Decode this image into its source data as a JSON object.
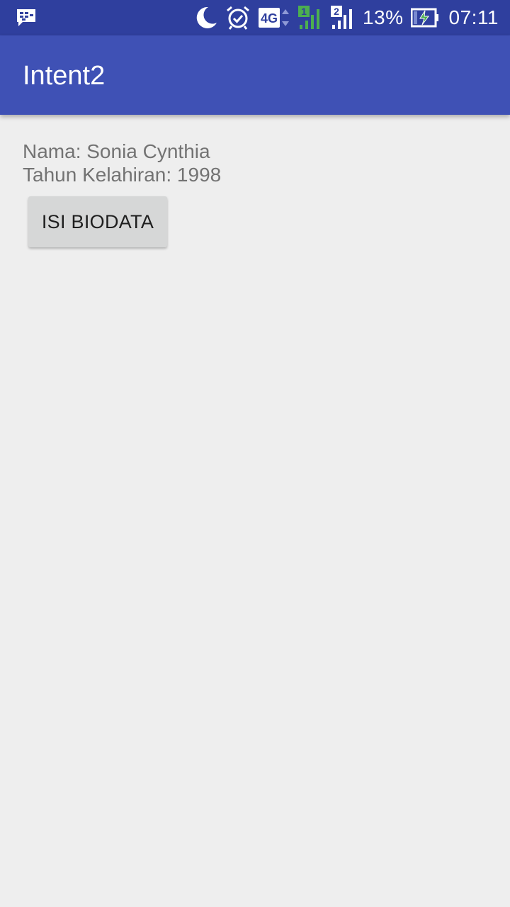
{
  "status_bar": {
    "battery_percent": "13%",
    "time": "07:11",
    "network_type": "4G",
    "sim1_label": "1",
    "sim2_label": "2",
    "icons": [
      "bbm-notification-icon",
      "do-not-disturb-moon-icon",
      "alarm-icon",
      "network-4g-icon",
      "signal-sim1-icon",
      "signal-sim2-icon",
      "battery-charging-icon"
    ],
    "background_color": "#2f3f9e"
  },
  "app_bar": {
    "title": "Intent2",
    "background_color": "#3f51b5"
  },
  "main": {
    "nama_line": "Nama: Sonia Cynthia",
    "tahun_line": "Tahun Kelahiran: 1998",
    "isi_button_label": "ISI BIODATA"
  }
}
